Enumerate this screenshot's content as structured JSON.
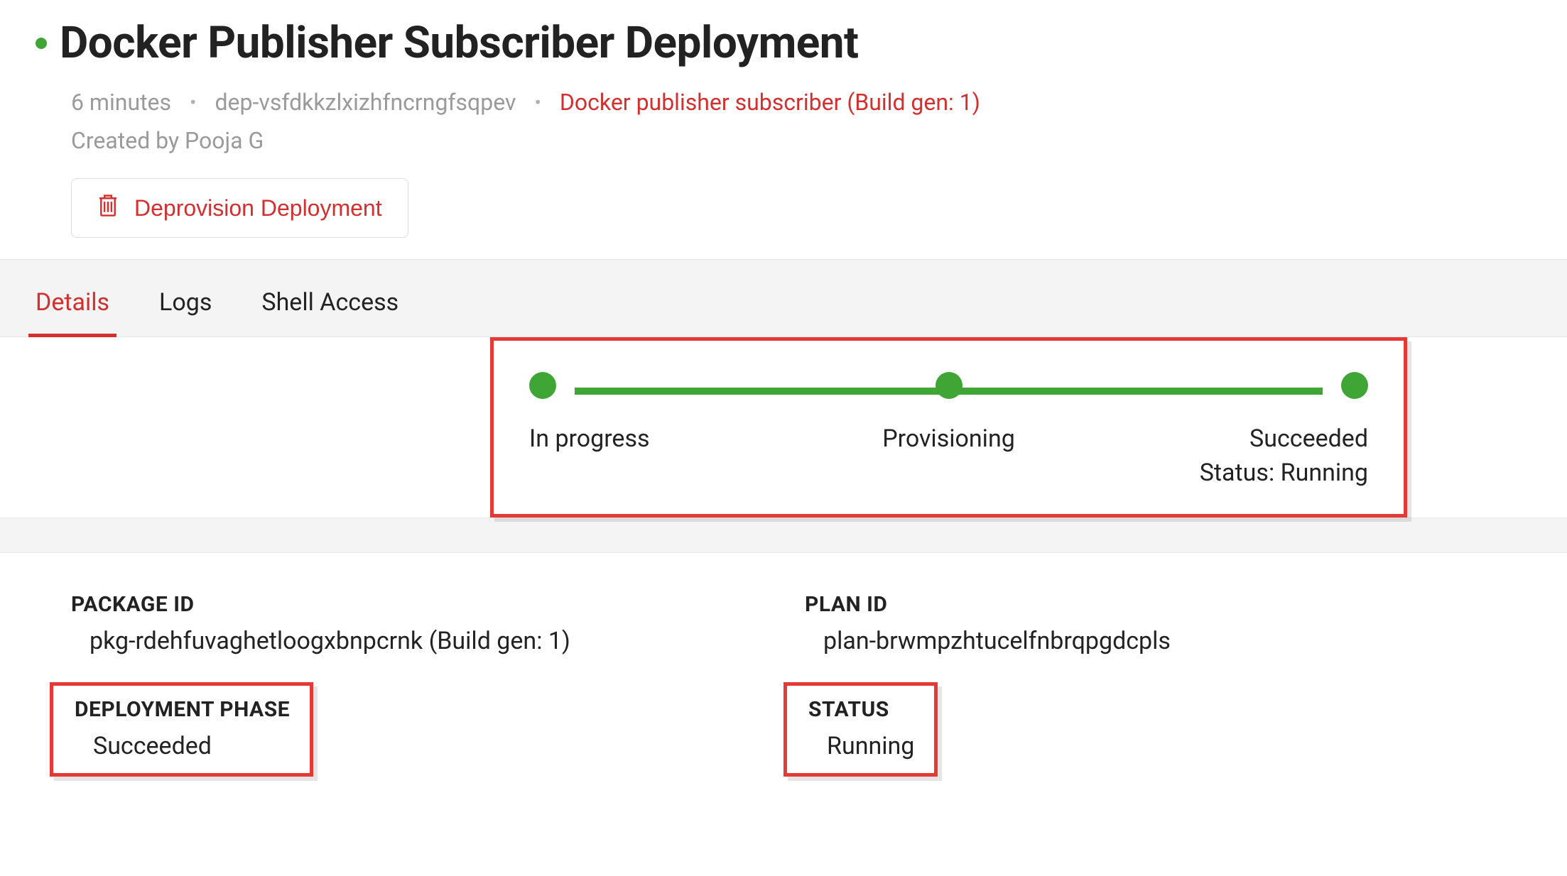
{
  "header": {
    "title": "Docker Publisher Subscriber Deployment",
    "age": "6 minutes",
    "deployment_id": "dep-vsfdkkzlxizhfncrngfsqpev",
    "package_link": "Docker publisher subscriber (Build gen: 1)",
    "created_by": "Created by Pooja G",
    "deprovision_label": "Deprovision Deployment"
  },
  "tabs": {
    "details": "Details",
    "logs": "Logs",
    "shell": "Shell Access"
  },
  "progress": {
    "step1": "In progress",
    "step2": "Provisioning",
    "step3": "Succeeded",
    "status_line": "Status: Running"
  },
  "details": {
    "package_id_label": "PACKAGE ID",
    "package_id_value": "pkg-rdehfuvaghetloogxbnpcrnk (Build gen: 1)",
    "plan_id_label": "PLAN ID",
    "plan_id_value": "plan-brwmpzhtucelfnbrqpgdcpls",
    "deployment_phase_label": "DEPLOYMENT PHASE",
    "deployment_phase_value": "Succeeded",
    "status_label": "STATUS",
    "status_value": "Running"
  }
}
